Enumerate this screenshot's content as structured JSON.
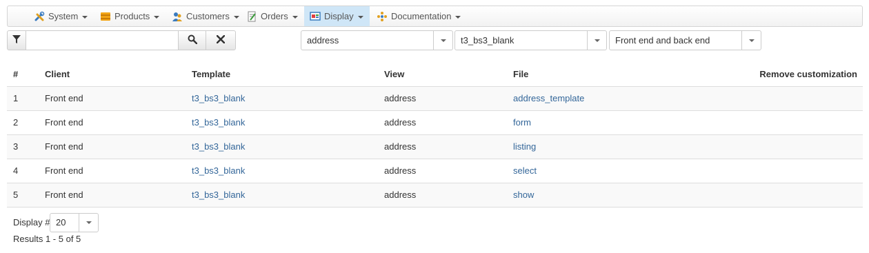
{
  "menu": [
    {
      "label": "System",
      "icon": "tools-icon"
    },
    {
      "label": "Products",
      "icon": "products-icon"
    },
    {
      "label": "Customers",
      "icon": "customers-icon"
    },
    {
      "label": "Orders",
      "icon": "orders-icon"
    },
    {
      "label": "Display",
      "icon": "display-icon",
      "active": true
    },
    {
      "label": "Documentation",
      "icon": "documentation-icon"
    }
  ],
  "filter": {
    "search_value": "",
    "view_select": "address",
    "template_select": "t3_bs3_blank",
    "client_select": "Front end and back end"
  },
  "table": {
    "headers": [
      "#",
      "Client",
      "Template",
      "View",
      "File",
      "Remove customization"
    ],
    "rows": [
      {
        "num": "1",
        "client": "Front end",
        "template": "t3_bs3_blank",
        "view": "address",
        "file": "address_template"
      },
      {
        "num": "2",
        "client": "Front end",
        "template": "t3_bs3_blank",
        "view": "address",
        "file": "form"
      },
      {
        "num": "3",
        "client": "Front end",
        "template": "t3_bs3_blank",
        "view": "address",
        "file": "listing"
      },
      {
        "num": "4",
        "client": "Front end",
        "template": "t3_bs3_blank",
        "view": "address",
        "file": "select"
      },
      {
        "num": "5",
        "client": "Front end",
        "template": "t3_bs3_blank",
        "view": "address",
        "file": "show"
      }
    ]
  },
  "pager": {
    "label": "Display #",
    "value": "20",
    "results": "Results 1 - 5 of 5"
  },
  "colors": {
    "link": "#336699",
    "active_menu": "#cfe6f7",
    "row_stripe": "#f9f9f9"
  }
}
